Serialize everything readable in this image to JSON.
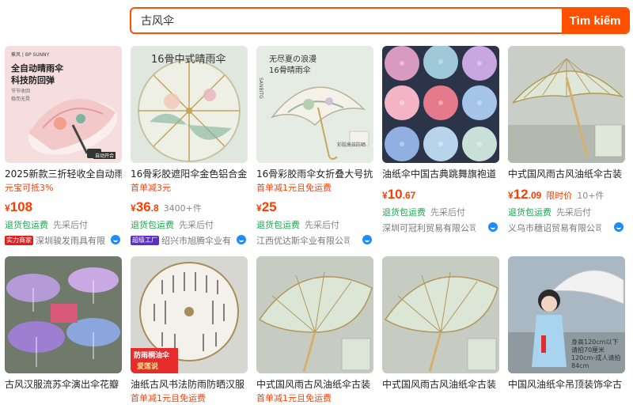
{
  "search": {
    "value": "古风伞",
    "button_label": "Tìm kiếm"
  },
  "products": [
    {
      "title": "2025新款三折轻收全自动雨",
      "promo": "元宝可抵3%",
      "price_int": "108",
      "price_dec": "",
      "price_extra": "",
      "tag1": "退货包运费",
      "tag2": "先采后付",
      "badge": "实力商家",
      "shop": "深圳骏发雨具有限",
      "image_text": [
        "蕉风 | BP SUNNY",
        "全自动晴雨伞",
        "科技防回弹",
        "节节收回",
        "稳而无晃",
        "自动开合"
      ]
    },
    {
      "title": "16骨彩胶遮阳伞金色铝合金",
      "promo": "首单减3元",
      "price_int": "36",
      "price_dec": ".8",
      "price_extra": "3400+件",
      "tag1": "退货包运费",
      "tag2": "先采后付",
      "badge": "超级工厂",
      "shop": "绍兴市旭腾伞业有",
      "image_text": [
        "16骨中式晴雨伞"
      ]
    },
    {
      "title": "16骨彩胶雨伞女折叠大号抗",
      "promo": "首单减1元且免运费",
      "price_int": "25",
      "price_dec": "",
      "price_extra": "",
      "tag1": "退货包运费",
      "tag2": "先采后付",
      "badge": "",
      "shop": "江西优达斯伞业有限公司",
      "image_text": [
        "无尽夏の浪漫",
        "16骨晴雨伞",
        "SANBITG",
        "彩胶高倍防晒"
      ]
    },
    {
      "title": "油纸伞中国古典跳舞旗袍道",
      "promo": "",
      "price_int": "10",
      "price_dec": ".67",
      "price_extra": "",
      "tag1": "退货包运费",
      "tag2": "先采后付",
      "badge": "",
      "shop": "深圳可冠利贸易有限公司",
      "image_text": []
    },
    {
      "title": "中式国风雨古风油纸伞古装",
      "promo": "",
      "price_int": "12",
      "price_dec": ".09",
      "price_extra": "10+件",
      "price_label": "限时价",
      "tag1": "退货包运费",
      "tag2": "先采后付",
      "badge": "",
      "shop": "义乌市穗诏贸易有限公司",
      "image_text": []
    },
    {
      "title": "古风汉服流苏伞演出伞花瓣",
      "image_text": []
    },
    {
      "title": "油纸古风书法防雨防晒汉服",
      "promo": "首单减1元且免运费",
      "image_text": [
        "防雨桐油伞",
        "爱莲说"
      ]
    },
    {
      "title": "中式国风雨古风油纸伞古装",
      "promo": "首单减1元且免运费",
      "image_text": []
    },
    {
      "title": "中式国风雨古风油纸伞古装",
      "image_text": []
    },
    {
      "title": "中国风油纸伞吊顶装饰伞古",
      "image_text": [
        "身高120cm以下",
        "请拍70厘米",
        "120cm-成人请拍",
        "84cm"
      ]
    }
  ],
  "icons": {
    "wangwang": "chat-icon",
    "accent": "#ff5000",
    "price_color": "#ff3d00",
    "tag_color": "#1fa84f"
  }
}
